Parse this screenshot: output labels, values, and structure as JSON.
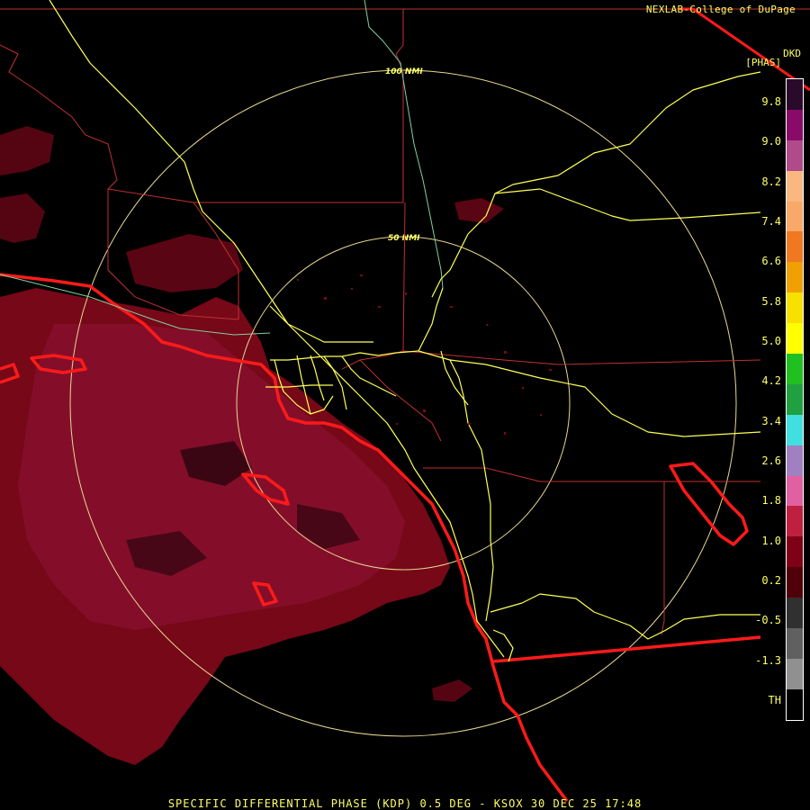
{
  "header": {
    "credit": "NEXLAB-College of DuPage",
    "product_code": "DKD",
    "units": "[PHAS]"
  },
  "rings": [
    {
      "label": "100 NMI"
    },
    {
      "label": "50 NMI"
    }
  ],
  "legend": {
    "ticks": [
      "9.8",
      "9.0",
      "8.2",
      "7.4",
      "6.6",
      "5.8",
      "5.0",
      "4.2",
      "3.4",
      "2.6",
      "1.8",
      "1.0",
      "0.2",
      "-0.5",
      "-1.3",
      "TH"
    ],
    "colors": [
      "#2a0a2a",
      "#8a0a6a",
      "#b04a8a",
      "#f8b880",
      "#f8a868",
      "#f07820",
      "#f0a000",
      "#f8e000",
      "#ffff00",
      "#20c020",
      "#20a040",
      "#40e0e0",
      "#a080c0",
      "#e060a0",
      "#c02040",
      "#800018",
      "#500008",
      "#303030",
      "#606060",
      "#909090",
      "#000000"
    ],
    "text_color": "#ffff66"
  },
  "footer": {
    "caption": "SPECIFIC DIFFERENTIAL PHASE (KDP) 0.5 DEG - KSOX 30 DEC 25 17:48"
  },
  "colors": {
    "background": "#000000",
    "echo": "#7a0818",
    "echo_light": "#8c1030",
    "coast": "#ff1a1a",
    "county": "#c03030",
    "highway": "#ffff55",
    "river": "#80d0a0",
    "ring": "#e8d890"
  }
}
